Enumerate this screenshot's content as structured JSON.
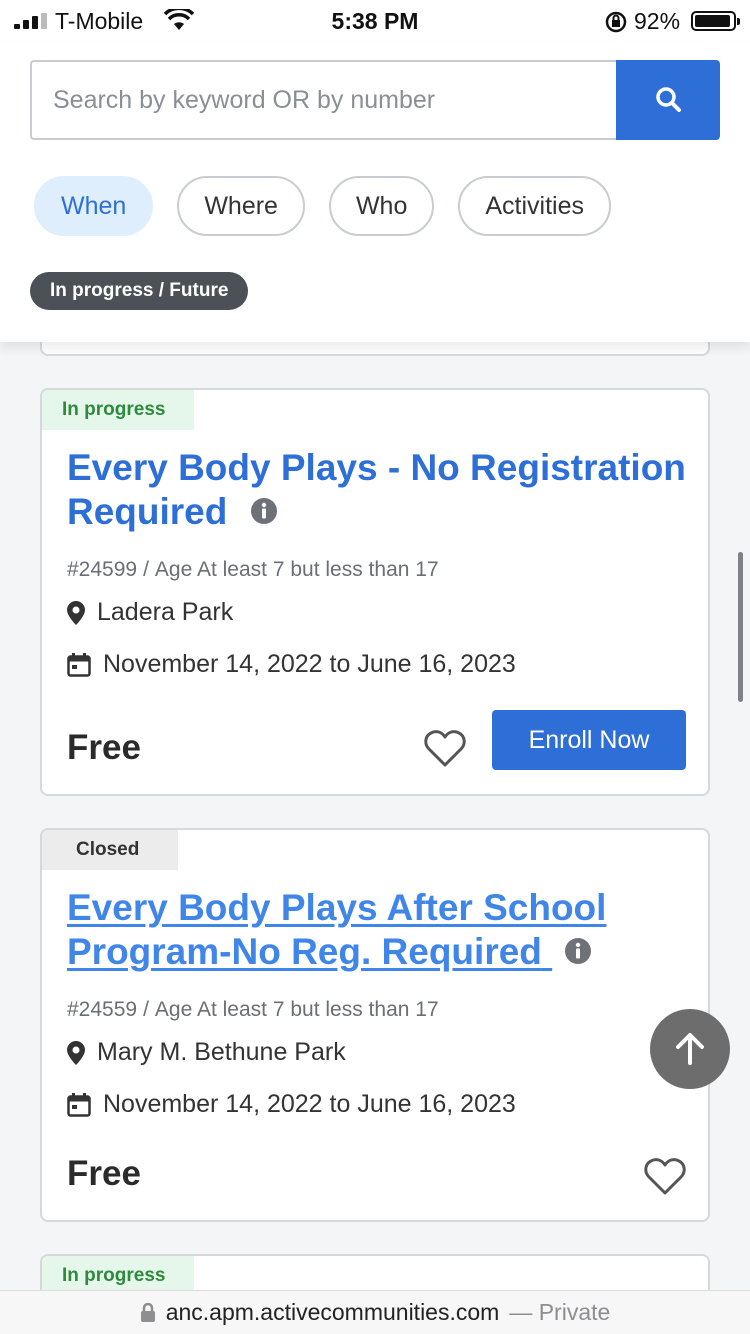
{
  "status_bar": {
    "carrier": "T-Mobile",
    "time": "5:38 PM",
    "battery": "92%"
  },
  "search": {
    "placeholder": "Search by keyword OR by number"
  },
  "filters": [
    "When",
    "Where",
    "Who",
    "Activities"
  ],
  "active_filter": "When",
  "active_tag": "In progress / Future",
  "results": [
    {
      "status": "In progress",
      "title_line1": "Every Body Plays - No Registration",
      "title_line2": "Required",
      "number": "#24599",
      "age": "Age At least 7 but less than 17",
      "location": "Ladera Park",
      "dates": "November 14, 2022 to June 16, 2023",
      "price": "Free",
      "action": "Enroll Now"
    },
    {
      "status": "Closed",
      "title_line1": "Every Body Plays After School",
      "title_line2": "Program-No Reg. Required",
      "number": "#24559",
      "age": "Age At least 7 but less than 17",
      "location": "Mary M. Bethune Park",
      "dates": "November 14, 2022 to June 16, 2023",
      "price": "Free"
    },
    {
      "status": "In progress"
    }
  ],
  "url_bar": {
    "domain": "anc.apm.activecommunities.com",
    "mode": "— Private"
  },
  "colors": {
    "primary": "#2d6fd6",
    "in_progress": "#2f8a3e",
    "chip": "#4b5157"
  },
  "icons": [
    "search-icon",
    "info-icon",
    "map-pin-icon",
    "calendar-icon",
    "heart-icon",
    "arrow-up-icon",
    "lock-icon"
  ]
}
